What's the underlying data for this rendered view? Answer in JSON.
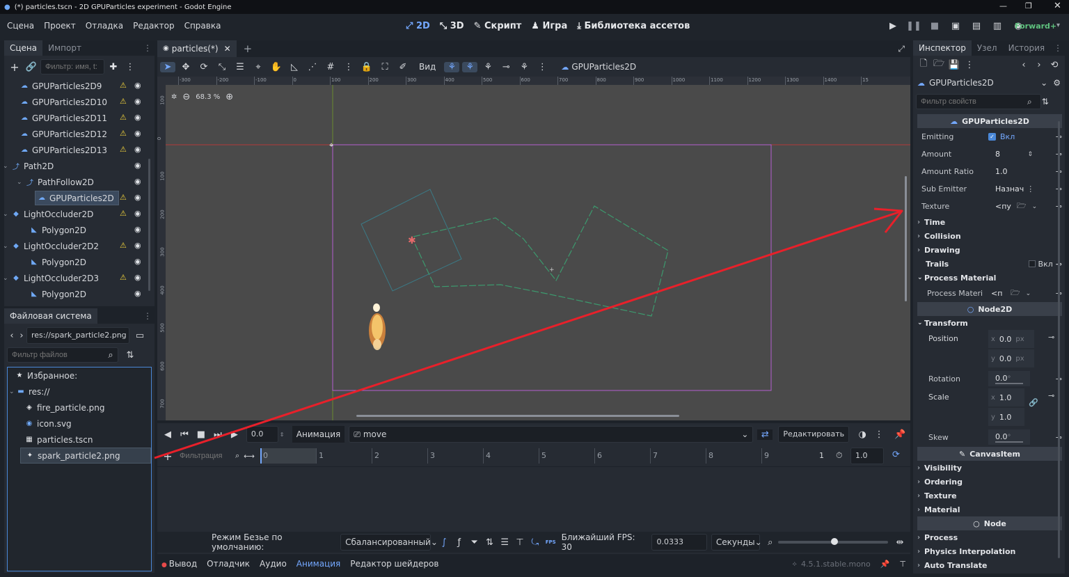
{
  "window": {
    "title": "(*) particles.tscn - 2D GPUParticles experiment - Godot Engine"
  },
  "menu": [
    "Сцена",
    "Проект",
    "Отладка",
    "Редактор",
    "Справка"
  ],
  "modes": [
    "2D",
    "3D",
    "Скрипт",
    "Игра",
    "Библиотека ассетов"
  ],
  "renderer": "Forward+",
  "scene_panel": {
    "tabs": [
      "Сцена",
      "Импорт"
    ],
    "filter_placeholder": "Фильтр: имя, t:",
    "nodes": [
      {
        "label": "GPUParticles2D9",
        "warn": true
      },
      {
        "label": "GPUParticles2D10",
        "warn": true
      },
      {
        "label": "GPUParticles2D11",
        "warn": true
      },
      {
        "label": "GPUParticles2D12",
        "warn": true
      },
      {
        "label": "GPUParticles2D13",
        "warn": true
      },
      {
        "label": "Path2D",
        "warn": false
      },
      {
        "label": "PathFollow2D",
        "warn": false
      },
      {
        "label": "GPUParticles2D",
        "warn": true
      },
      {
        "label": "LightOccluder2D",
        "warn": true
      },
      {
        "label": "Polygon2D",
        "warn": false
      },
      {
        "label": "LightOccluder2D2",
        "warn": true
      },
      {
        "label": "Polygon2D",
        "warn": false
      },
      {
        "label": "LightOccluder2D3",
        "warn": true
      },
      {
        "label": "Polygon2D",
        "warn": false
      }
    ]
  },
  "filesystem": {
    "title": "Файловая система",
    "path": "res://spark_particle2.png",
    "filter_placeholder": "Фильтр файлов",
    "items": [
      "Избранное:",
      "res://",
      "fire_particle.png",
      "icon.svg",
      "particles.tscn",
      "spark_particle2.png"
    ]
  },
  "editor": {
    "tab": "particles(*)",
    "view_label": "Вид",
    "selected_node": "GPUParticles2D",
    "zoom": "68.3 %",
    "ruler_top": [
      "-300",
      "-200",
      "-100",
      "0",
      "100",
      "200",
      "300",
      "400",
      "500",
      "600",
      "700",
      "800",
      "900",
      "1000",
      "1100",
      "1200",
      "1300",
      "1400",
      "15"
    ],
    "ruler_left": [
      "100",
      "0",
      "100",
      "200",
      "300",
      "400",
      "500",
      "600",
      "700"
    ]
  },
  "animation": {
    "time": "0.0",
    "label": "Анимация",
    "name": "move",
    "edit": "Редактировать",
    "filter_placeholder": "Фильтрация",
    "ticks": [
      "0",
      "1",
      "2",
      "3",
      "4",
      "5",
      "6",
      "7",
      "8",
      "9"
    ],
    "length_label": "1",
    "length": "1.0",
    "bezier_label": "Режим Безье по умолчанию:",
    "bezier_value": "Сбалансированный",
    "fps_badge": "FPS",
    "fps_label": "Ближайший FPS: 30",
    "step": "0.0333",
    "unit": "Секунды"
  },
  "bottom_tabs": [
    "Вывод",
    "Отладчик",
    "Аудио",
    "Анимация",
    "Редактор шейдеров"
  ],
  "version": "4.5.1.stable.mono",
  "inspector": {
    "tabs": [
      "Инспектор",
      "Узел",
      "История"
    ],
    "object": "GPUParticles2D",
    "filter_placeholder": "Фильтр свойств",
    "class_header": "GPUParticles2D",
    "props": [
      {
        "label": "Emitting",
        "value": "Вкл"
      },
      {
        "label": "Amount",
        "value": "8"
      },
      {
        "label": "Amount Ratio",
        "value": "1.0"
      },
      {
        "label": "Sub Emitter",
        "value": "Назнач"
      },
      {
        "label": "Texture",
        "value": "<пу"
      }
    ],
    "sections1": [
      "Time",
      "Collision",
      "Drawing"
    ],
    "trails": {
      "label": "Trails",
      "value": "Вкл"
    },
    "process_material": {
      "label": "Process Material",
      "prop": "Process Materi",
      "value": "<п"
    },
    "node2d_header": "Node2D",
    "transform": {
      "label": "Transform",
      "position": {
        "label": "Position",
        "x": "0.0",
        "y": "0.0",
        "unit": "px"
      },
      "rotation": {
        "label": "Rotation",
        "value": "0.0",
        "unit": "°"
      },
      "scale": {
        "label": "Scale",
        "x": "1.0",
        "y": "1.0"
      },
      "skew": {
        "label": "Skew",
        "value": "0.0",
        "unit": "°"
      }
    },
    "canvasitem_header": "CanvasItem",
    "sections2": [
      "Visibility",
      "Ordering",
      "Texture",
      "Material"
    ],
    "node_header": "Node",
    "sections3": [
      "Process",
      "Physics Interpolation",
      "Auto Translate"
    ]
  },
  "colors": {
    "accent": "#74a8ff",
    "warning": "#f2d33b",
    "annotation_arrow": "#e8202a",
    "path": "#3c9a6e",
    "bounds": "#b45fd0"
  }
}
